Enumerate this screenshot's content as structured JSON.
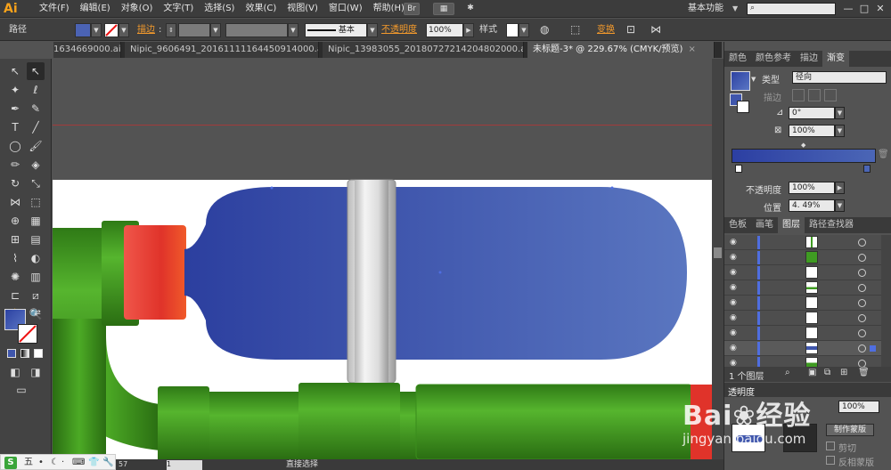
{
  "app": {
    "logo": "Ai"
  },
  "menu": [
    "文件(F)",
    "编辑(E)",
    "对象(O)",
    "文字(T)",
    "选择(S)",
    "效果(C)",
    "视图(V)",
    "窗口(W)",
    "帮助(H)"
  ],
  "menubar_icons": {
    "br": "Br",
    "arrange": "▦",
    "gpu": "✱"
  },
  "workspace": {
    "label": "基本功能",
    "arrow": "▼"
  },
  "search": {
    "placeholder": ""
  },
  "window_buttons": {
    "minimize": "—",
    "maximize": "□",
    "close": "✕"
  },
  "controlbar": {
    "selection_label": "路径",
    "stroke_label": "描边",
    "stroke_sep": ":",
    "brush_label": "基本",
    "opacity_label": "不透明度",
    "opacity_value": "100%",
    "style_label": "样式",
    "transform_label": "变换"
  },
  "tabs": [
    {
      "label": "1634669000.ai*",
      "active": false
    },
    {
      "label": "Nipic_9606491_20161111164450914000.ai*",
      "active": false
    },
    {
      "label": "Nipic_13983055_20180727214204802000.ai*",
      "active": false
    },
    {
      "label": "未标题-3* @ 229.67% (CMYK/预览)",
      "active": true
    }
  ],
  "status": {
    "tool": "直接选择",
    "zoom": "57",
    "page": "1"
  },
  "colors": {
    "accent": "#f39a2c",
    "fill_blue": "#3f56ac",
    "green": "#3f9b22",
    "red": "#e0332a"
  },
  "gradient_panel": {
    "tabs": [
      "颜色",
      "颜色参考",
      "描边",
      "渐变"
    ],
    "type_label": "类型",
    "type_value": "径向",
    "stroke_label": "描边",
    "angle_value": "0°",
    "aspect_value": "100%",
    "opacity_label": "不透明度",
    "opacity_value": "100%",
    "location_label": "位置",
    "location_value": "4. 49%"
  },
  "layers_panel": {
    "tabs": [
      "色板",
      "画笔",
      "图层",
      "路径查找器"
    ],
    "count_label": "1 个图层"
  },
  "transparency_panel": {
    "tab": "透明度",
    "mode_field": "100%",
    "make_mask": "制作蒙版",
    "clip": "剪切",
    "invert": "反相蒙版"
  },
  "ime": {
    "brand": "S",
    "mode": "五"
  },
  "watermark": {
    "logo": "Bai❀经验",
    "url": "jingyan.baidu.com"
  }
}
